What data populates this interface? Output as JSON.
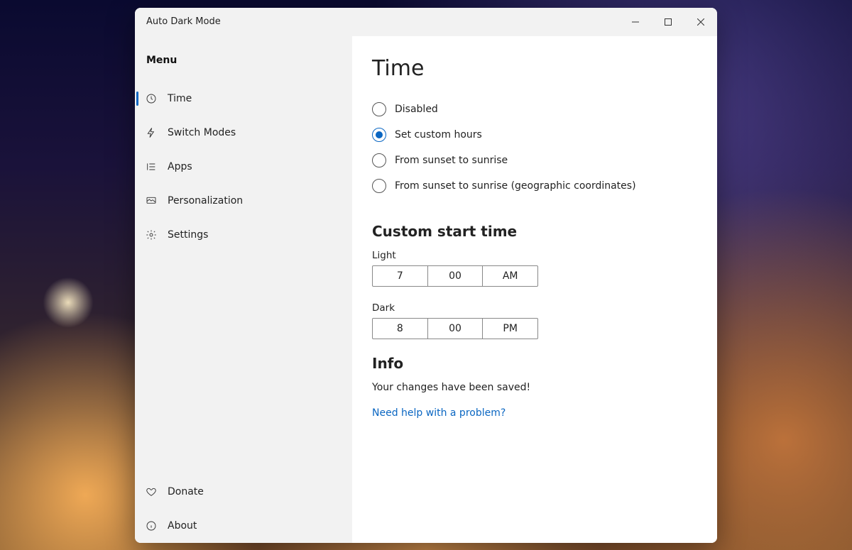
{
  "window_title": "Auto Dark Mode",
  "sidebar": {
    "header": "Menu",
    "items": [
      {
        "label": "Time"
      },
      {
        "label": "Switch Modes"
      },
      {
        "label": "Apps"
      },
      {
        "label": "Personalization"
      },
      {
        "label": "Settings"
      }
    ],
    "footer": [
      {
        "label": "Donate"
      },
      {
        "label": "About"
      }
    ]
  },
  "main": {
    "title": "Time",
    "radios": {
      "disabled": "Disabled",
      "custom": "Set custom hours",
      "sun": "From sunset to sunrise",
      "geo": "From sunset to sunrise (geographic coordinates)",
      "selected": "custom"
    },
    "custom": {
      "heading": "Custom start time",
      "light_label": "Light",
      "light": {
        "hour": "7",
        "minute": "00",
        "ampm": "AM"
      },
      "dark_label": "Dark",
      "dark": {
        "hour": "8",
        "minute": "00",
        "ampm": "PM"
      }
    },
    "info": {
      "heading": "Info",
      "body": "Your changes have been saved!",
      "help": "Need help with a problem?"
    }
  }
}
